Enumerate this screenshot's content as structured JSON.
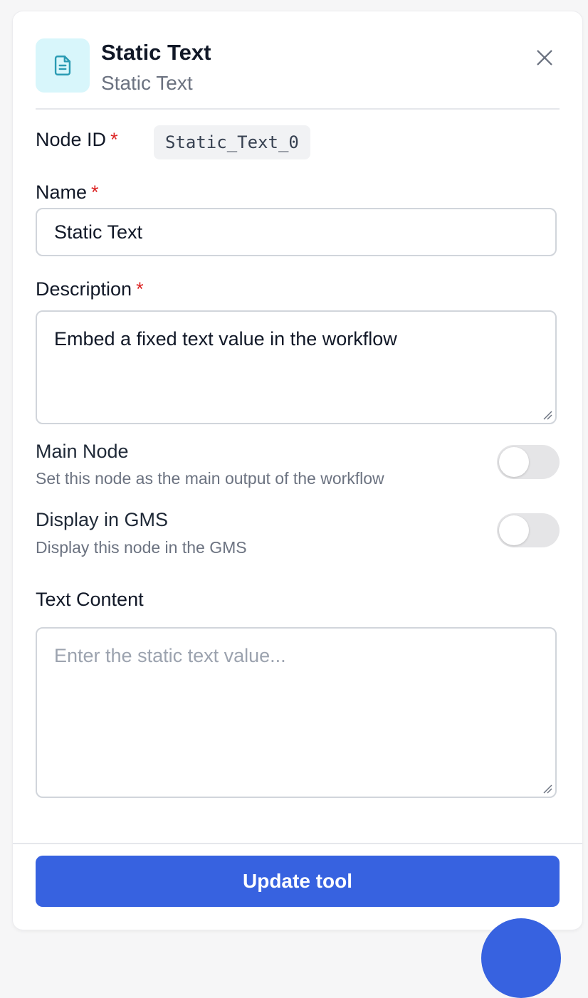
{
  "header": {
    "title": "Static Text",
    "subtitle": "Static Text",
    "icon": "document-icon",
    "close_icon": "close-icon"
  },
  "form": {
    "node_id": {
      "label": "Node ID",
      "required": "*",
      "value": "Static_Text_0"
    },
    "name": {
      "label": "Name",
      "required": "*",
      "value": "Static Text"
    },
    "description": {
      "label": "Description",
      "required": "*",
      "value": "Embed a fixed text value in the workflow"
    },
    "main_node": {
      "title": "Main Node",
      "description": "Set this node as the main output of the workflow",
      "enabled": false
    },
    "display_in_gms": {
      "title": "Display in GMS",
      "description": "Display this node in the GMS",
      "enabled": false
    },
    "text_content": {
      "label": "Text Content",
      "placeholder": "Enter the static text value...",
      "value": ""
    }
  },
  "footer": {
    "submit_label": "Update tool"
  },
  "colors": {
    "primary": "#3762e0",
    "required": "#dc2626",
    "icon_bg": "#d8f6fb",
    "icon_fg": "#2a9bb3"
  }
}
